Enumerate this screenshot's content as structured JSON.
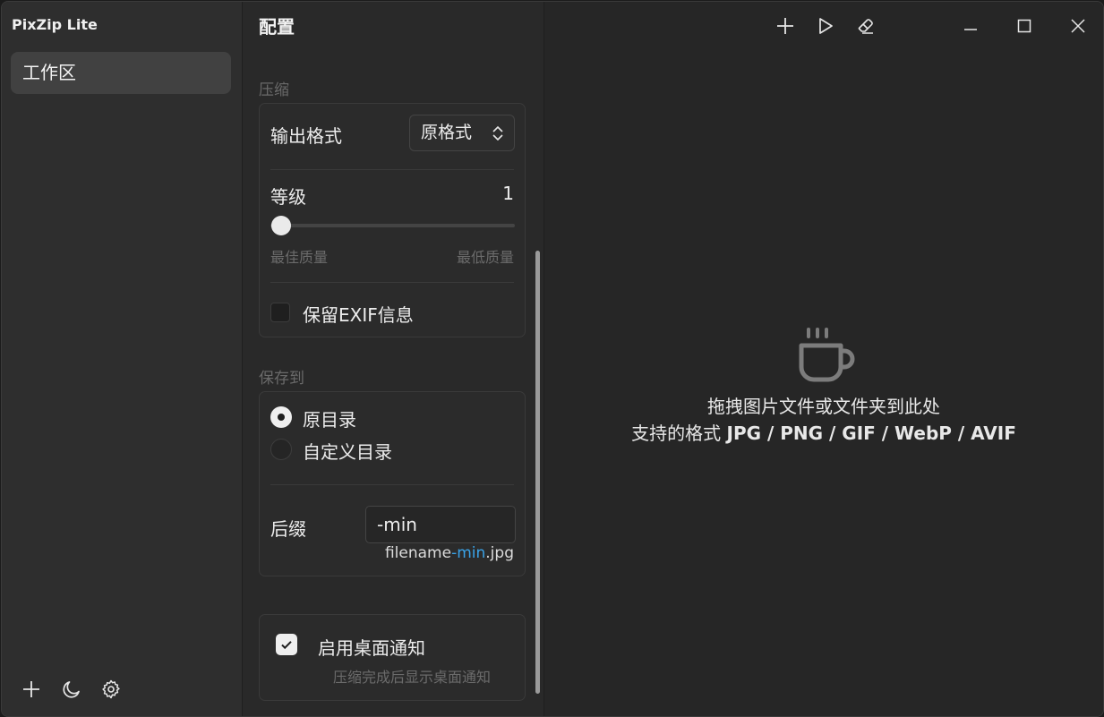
{
  "app": {
    "title": "PixZip Lite"
  },
  "sidebar": {
    "items": [
      {
        "label": "工作区",
        "active": true
      }
    ],
    "bottom_icons": [
      "plus-icon",
      "moon-icon",
      "gear-icon"
    ]
  },
  "config": {
    "title": "配置",
    "compress": {
      "section_label": "压缩",
      "output_format_label": "输出格式",
      "output_format_value": "原格式",
      "level_label": "等级",
      "level_value": "1",
      "level_fraction": 0.0,
      "slider_min_label": "最佳质量",
      "slider_max_label": "最低质量",
      "keep_exif_label": "保留EXIF信息",
      "keep_exif_checked": false
    },
    "save_to": {
      "section_label": "保存到",
      "option_original": "原目录",
      "option_custom": "自定义目录",
      "selected": "原目录",
      "suffix_label": "后缀",
      "suffix_value": "-min",
      "preview_base": "filename",
      "preview_suffix": "-min",
      "preview_ext": ".jpg"
    },
    "notify": {
      "label": "启用桌面通知",
      "hint": "压缩完成后显示桌面通知",
      "checked": true
    }
  },
  "main": {
    "toolbar_icons": [
      "plus-icon",
      "play-icon",
      "eraser-icon"
    ],
    "window_controls": [
      "minimize-icon",
      "maximize-icon",
      "close-icon"
    ],
    "drop_hint": "拖拽图片文件或文件夹到此处",
    "formats_prefix": "支持的格式",
    "formats_list": "JPG / PNG / GIF / WebP / AVIF"
  },
  "colors": {
    "accent": "#3aa3e8",
    "background": "#272727"
  }
}
